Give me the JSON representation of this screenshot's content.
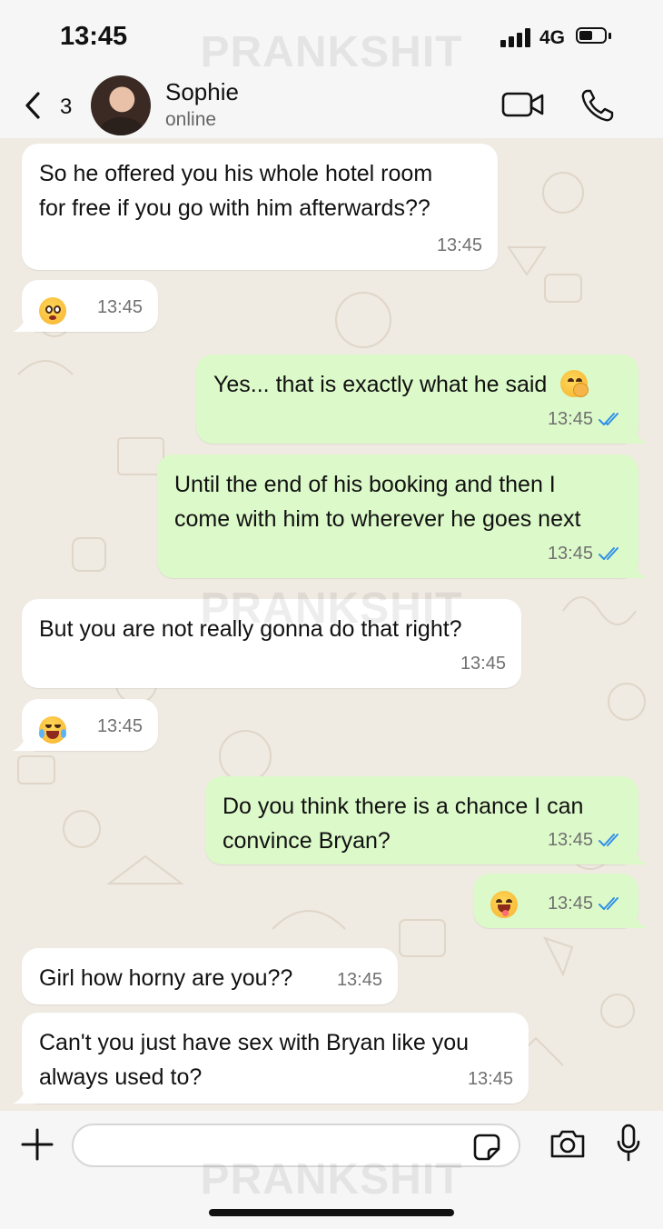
{
  "status_bar": {
    "time": "13:45",
    "network": "4G",
    "battery_level": 0.55
  },
  "watermark": "PRANKSHIT",
  "header": {
    "unread_count": "3",
    "contact_name": "Sophie",
    "contact_status": "online"
  },
  "messages": [
    {
      "direction": "incoming",
      "lines": [
        "So he offered you his whole hotel room",
        "for free if you go with him afterwards??"
      ],
      "time": "13:45"
    },
    {
      "direction": "incoming",
      "emoji": "flushed-face",
      "time": "13:45"
    },
    {
      "direction": "outgoing",
      "text": "Yes... that is exactly what he said",
      "emoji": "face-with-hand-over-mouth",
      "time": "13:45",
      "read": true
    },
    {
      "direction": "outgoing",
      "lines": [
        "Until the end of his booking and then I",
        "come with him to wherever he goes next"
      ],
      "time": "13:45",
      "read": true
    },
    {
      "direction": "incoming",
      "text": "But you are not really gonna do that right?",
      "time": "13:45"
    },
    {
      "direction": "incoming",
      "emoji": "face-with-tears-of-joy",
      "time": "13:45"
    },
    {
      "direction": "outgoing",
      "lines": [
        "Do you think there is a chance I can",
        "convince Bryan?"
      ],
      "time": "13:45",
      "read": true
    },
    {
      "direction": "outgoing",
      "emoji": "winking-face-with-tongue",
      "time": "13:45",
      "read": true
    },
    {
      "direction": "incoming",
      "text": "Girl how horny are you??",
      "time": "13:45"
    },
    {
      "direction": "incoming",
      "lines": [
        "Can't you just have sex with Bryan like you",
        "always used to?"
      ],
      "time": "13:45"
    }
  ],
  "composer": {
    "placeholder": ""
  },
  "colors": {
    "incoming_bubble": "#ffffff",
    "outgoing_bubble": "#dcf9c9",
    "chat_background": "#efeae2",
    "read_ticks": "#2f8fe8"
  }
}
